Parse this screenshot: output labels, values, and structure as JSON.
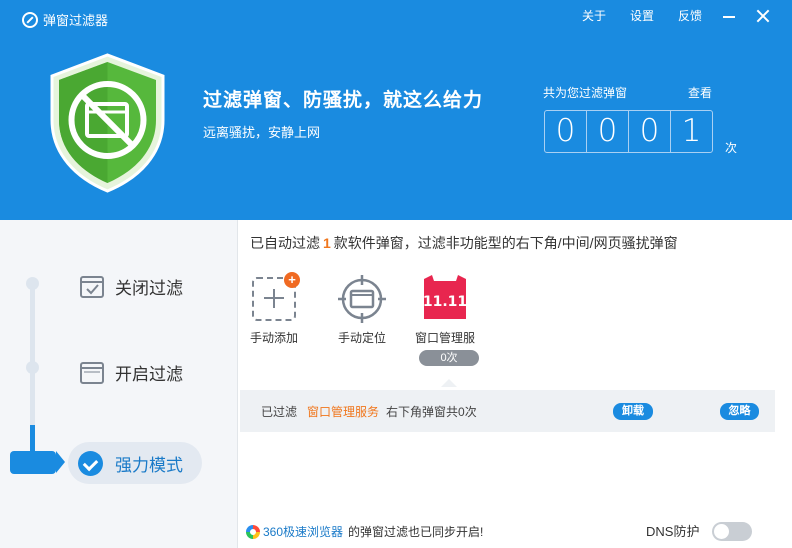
{
  "app": {
    "title": "弹窗过滤器"
  },
  "top_links": {
    "about": "关于",
    "settings": "设置",
    "feedback": "反馈"
  },
  "hero": {
    "slogan": "过滤弹窗、防骚扰，就这么给力",
    "subslogan": "远离骚扰，安静上网"
  },
  "counter": {
    "label": "共为您过滤弹窗",
    "view": "查看",
    "digits": [
      "0",
      "0",
      "0",
      "1"
    ],
    "unit": "次"
  },
  "modes": {
    "close": "关闭过滤",
    "open": "开启过滤",
    "strong": "强力模式",
    "active": "强力模式"
  },
  "info": {
    "prefix": "已自动过滤",
    "count": "1",
    "suffix": "款软件弹窗，过滤非功能型的右下角/中间/网页骚扰弹窗"
  },
  "tools": {
    "manual_add": "手动添加",
    "manual_locate": "手动定位",
    "window_mgr": "窗口管理服",
    "window_mgr_badge": "11.11",
    "window_mgr_count": "0次"
  },
  "filter_row": {
    "prefix": "已过滤",
    "service": "窗口管理服务",
    "detail": "右下角弹窗共0次",
    "uninstall": "卸载",
    "ignore": "忽略"
  },
  "footer": {
    "browser": "360极速浏览器",
    "text": "的弹窗过滤也已同步开启!",
    "dns_label": "DNS防护",
    "dns_enabled": false
  },
  "colors": {
    "primary": "#1a8be0",
    "shield_green": "#56b83c",
    "accent_orange": "#f0761c",
    "tmall_red": "#e8264f"
  }
}
